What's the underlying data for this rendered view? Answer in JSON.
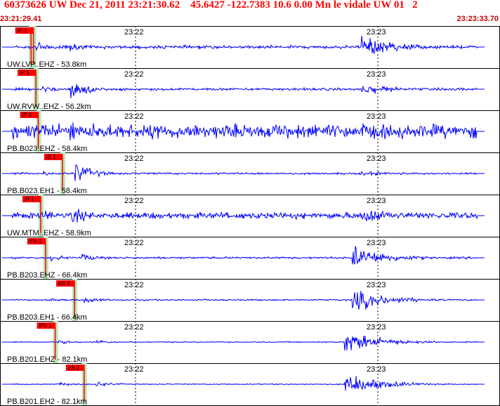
{
  "header": {
    "title": "60373626 UW Dec 21, 2011 23:21:30.62    45.6427 -122.7383 10.6 0.00 Mn le vidale UW 01   2",
    "start_time": "23:21:29.41",
    "end_time": "23:23:33.70"
  },
  "colors": {
    "trace": "#0000ff",
    "pick": "#ff0000",
    "shade": "#b8e6b8",
    "header_text": "#ff0000"
  },
  "time_labels": [
    "23:22",
    "23:23"
  ],
  "channels": [
    {
      "label": "UW.LVP..EHZ - 53.8km",
      "picks": [
        {
          "text": "iP 1",
          "t": 0.065
        },
        {
          "text": "",
          "t": 0.06
        }
      ],
      "p_onset": 0.07,
      "s_onset": 0.13,
      "eq_onset": 0.745,
      "noise": 0.12,
      "p_amp": 0.55,
      "s_amp": 0.45,
      "eq_amp": 0.95
    },
    {
      "label": "UW.RVW..EHZ - 56.2km",
      "picks": [
        {
          "text": "iP 1",
          "t": 0.07
        }
      ],
      "p_onset": 0.08,
      "s_onset": 0.14,
      "eq_onset": 0.745,
      "noise": 0.1,
      "p_amp": 0.35,
      "s_amp": 0.95,
      "eq_amp": 0.45
    },
    {
      "label": "PB.B023.EHZ - 58.4km",
      "picks": [
        {
          "text": "iP 2",
          "t": 0.075
        }
      ],
      "p_onset": 0.08,
      "s_onset": 0.14,
      "eq_onset": 0.745,
      "noise": 0.55,
      "p_amp": 0.6,
      "s_amp": 0.95,
      "eq_amp": 0.7
    },
    {
      "label": "PB.B023.EH1 - 58.4km",
      "picks": [
        {
          "text": "iS 1",
          "t": 0.125
        }
      ],
      "p_onset": 0.085,
      "s_onset": 0.15,
      "eq_onset": 0.745,
      "noise": 0.08,
      "p_amp": 0.2,
      "s_amp": 0.95,
      "eq_amp": 0.2
    },
    {
      "label": "UW.MTM..EHZ - 58.9km",
      "picks": [
        {
          "text": "iP 1",
          "t": 0.08
        }
      ],
      "p_onset": 0.09,
      "s_onset": 0.145,
      "eq_onset": 0.745,
      "noise": 0.25,
      "p_amp": 0.45,
      "s_amp": 0.75,
      "eq_amp": 0.75
    },
    {
      "label": "PB.B203.EHZ - 66.4km",
      "picks": [
        {
          "text": "iPc 1",
          "t": 0.09
        }
      ],
      "p_onset": 0.1,
      "s_onset": 0.165,
      "eq_onset": 0.725,
      "noise": 0.08,
      "p_amp": 0.3,
      "s_amp": 0.35,
      "eq_amp": 0.95
    },
    {
      "label": "PB.B203.EH1 - 66.4km",
      "picks": [
        {
          "text": "eS 2",
          "t": 0.15
        }
      ],
      "p_onset": 0.1,
      "s_onset": 0.17,
      "eq_onset": 0.725,
      "noise": 0.06,
      "p_amp": 0.15,
      "s_amp": 0.3,
      "eq_amp": 0.95
    },
    {
      "label": "PB.B201.EHZ - 82.1km",
      "picks": [
        {
          "text": "iPc 1",
          "t": 0.11
        }
      ],
      "p_onset": 0.115,
      "s_onset": 0.195,
      "eq_onset": 0.71,
      "noise": 0.04,
      "p_amp": 0.2,
      "s_amp": 0.2,
      "eq_amp": 0.95
    },
    {
      "label": "PB.B201.EH2 - 82.1km",
      "picks": [
        {
          "text": "eS 2",
          "t": 0.17
        }
      ],
      "p_onset": 0.115,
      "s_onset": 0.195,
      "eq_onset": 0.71,
      "noise": 0.04,
      "p_amp": 0.2,
      "s_amp": 0.25,
      "eq_amp": 0.95
    }
  ]
}
